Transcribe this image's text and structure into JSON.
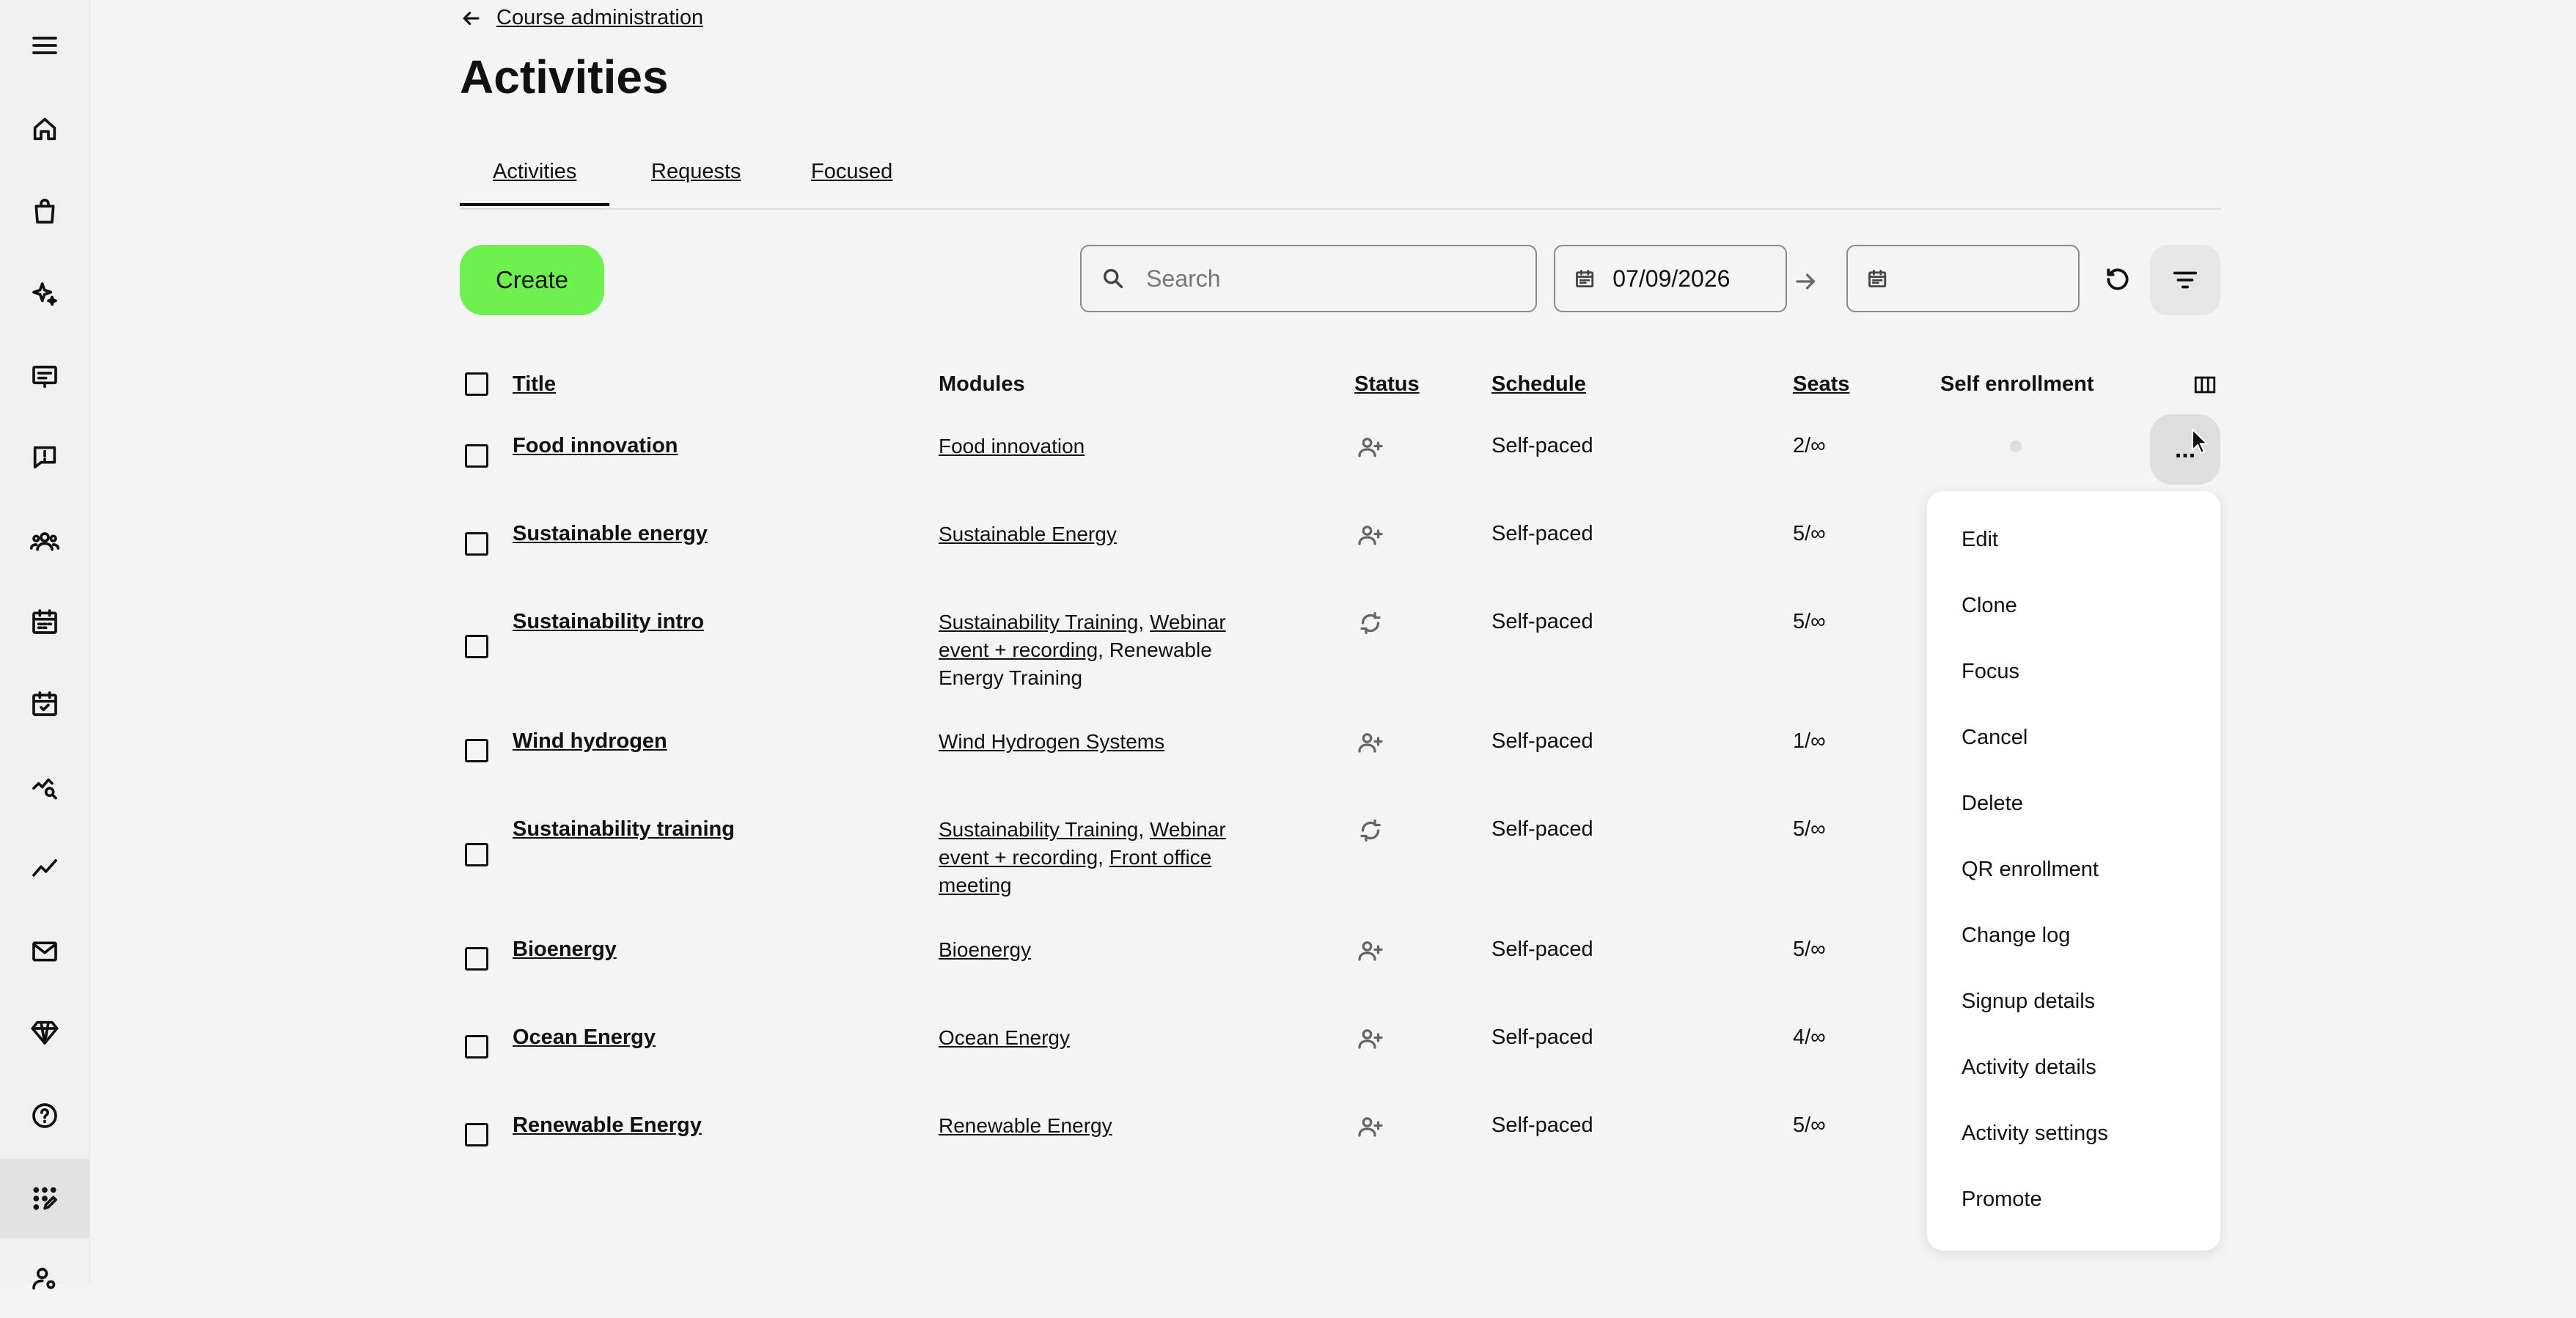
{
  "sidebar": {
    "items": [
      {
        "icon": "menu-icon"
      },
      {
        "icon": "home-icon"
      },
      {
        "icon": "shopping-bag-icon"
      },
      {
        "icon": "sparkles-icon"
      },
      {
        "icon": "presentation-icon"
      },
      {
        "icon": "message-alert-icon"
      },
      {
        "icon": "users-icon"
      },
      {
        "icon": "calendar-grid-icon"
      },
      {
        "icon": "calendar-check-icon"
      },
      {
        "icon": "chart-search-icon"
      },
      {
        "icon": "trend-line-icon"
      },
      {
        "icon": "mail-icon"
      },
      {
        "icon": "diamond-icon"
      },
      {
        "icon": "help-icon"
      },
      {
        "icon": "grid-edit-icon",
        "active": true
      },
      {
        "icon": "user-settings-icon"
      }
    ]
  },
  "header": {
    "back_label": "Course administration",
    "title": "Activities"
  },
  "tabs": [
    {
      "label": "Activities",
      "active": true
    },
    {
      "label": "Requests",
      "active": false
    },
    {
      "label": "Focused",
      "active": false
    }
  ],
  "toolbar": {
    "create_label": "Create",
    "search_placeholder": "Search",
    "start_date": "07/09/2026",
    "end_date": ""
  },
  "table": {
    "columns": {
      "title": "Title",
      "modules": "Modules",
      "status": "Status",
      "schedule": "Schedule",
      "seats": "Seats",
      "self_enrollment": "Self enrollment"
    },
    "rows": [
      {
        "title": "Food innovation",
        "modules": [
          "Food innovation"
        ],
        "status_icon": "user-plus-icon",
        "schedule": "Self-paced",
        "seats": "2/∞"
      },
      {
        "title": "Sustainable energy",
        "modules": [
          "Sustainable Energy"
        ],
        "status_icon": "user-plus-icon",
        "schedule": "Self-paced",
        "seats": "5/∞"
      },
      {
        "title": "Sustainability intro",
        "modules": [
          "Sustainability Training",
          "Webinar event + recording",
          "Renewable Energy Training"
        ],
        "status_icon": "refresh-icon",
        "schedule": "Self-paced",
        "seats": "5/∞"
      },
      {
        "title": "Wind hydrogen",
        "modules": [
          "Wind Hydrogen Systems"
        ],
        "status_icon": "user-plus-icon",
        "schedule": "Self-paced",
        "seats": "1/∞"
      },
      {
        "title": "Sustainability training",
        "modules": [
          "Sustainability Training",
          "Webinar event + recording",
          "Front office meeting"
        ],
        "status_icon": "refresh-icon",
        "schedule": "Self-paced",
        "seats": "5/∞"
      },
      {
        "title": "Bioenergy",
        "modules": [
          "Bioenergy"
        ],
        "status_icon": "user-plus-icon",
        "schedule": "Self-paced",
        "seats": "5/∞"
      },
      {
        "title": "Ocean Energy",
        "modules": [
          "Ocean Energy"
        ],
        "status_icon": "user-plus-icon",
        "schedule": "Self-paced",
        "seats": "4/∞"
      },
      {
        "title": "Renewable Energy",
        "modules": [
          "Renewable Energy"
        ],
        "status_icon": "user-plus-icon",
        "schedule": "Self-paced",
        "seats": "5/∞"
      }
    ]
  },
  "row_menu": {
    "more_label": "...",
    "items": [
      "Edit",
      "Clone",
      "Focus",
      "Cancel",
      "Delete",
      "QR enrollment",
      "Change log",
      "Signup details",
      "Activity details",
      "Activity settings",
      "Promote"
    ]
  },
  "colors": {
    "accent": "#6ef04f",
    "background": "#f4f4f4"
  }
}
